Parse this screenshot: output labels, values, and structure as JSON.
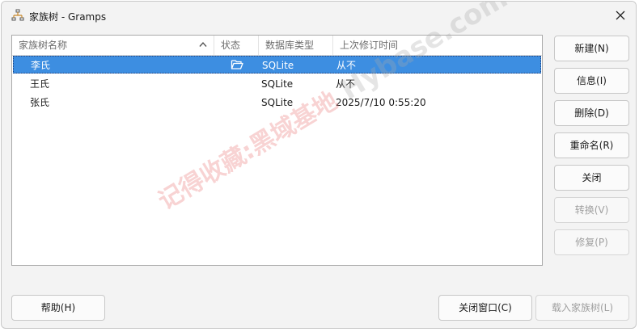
{
  "window": {
    "title": "家族树 - Gramps",
    "icons": {
      "app": "family-tree-icon",
      "close": "close-icon"
    }
  },
  "table": {
    "columns": [
      {
        "label": "家族树名称",
        "sorted": "ascending"
      },
      {
        "label": "状态"
      },
      {
        "label": "数据库类型"
      },
      {
        "label": "上次修订时间"
      }
    ],
    "rows": [
      {
        "name": "李氏",
        "status_icon": "open-folder-icon",
        "db_type": "SQLite",
        "last_modified": "从不",
        "selected": true
      },
      {
        "name": "王氏",
        "status_icon": "",
        "db_type": "SQLite",
        "last_modified": "从不",
        "selected": false
      },
      {
        "name": "张氏",
        "status_icon": "",
        "db_type": "SQLite",
        "last_modified": "2025/7/10 0:55:20",
        "selected": false
      }
    ]
  },
  "side_buttons": {
    "new": {
      "label": "新建(N)",
      "enabled": true
    },
    "info": {
      "label": "信息(I)",
      "enabled": true
    },
    "delete": {
      "label": "删除(D)",
      "enabled": true
    },
    "rename": {
      "label": "重命名(R)",
      "enabled": true
    },
    "close": {
      "label": "关闭",
      "enabled": true
    },
    "convert": {
      "label": "转换(V)",
      "enabled": false
    },
    "repair": {
      "label": "修复(P)",
      "enabled": false
    }
  },
  "bottom_buttons": {
    "help": {
      "label": "帮助(H)",
      "enabled": true
    },
    "close_window": {
      "label": "关闭窗口(C)",
      "enabled": true
    },
    "load_tree": {
      "label": "载入家族树(L)",
      "enabled": false
    }
  },
  "watermark": {
    "main": "记得收藏:黑域基地",
    "sub": "Hybase.com"
  },
  "colors": {
    "selection": "#3d8ee1",
    "disabled_text": "#a0a0a0",
    "watermark_red": "#eb8282"
  }
}
